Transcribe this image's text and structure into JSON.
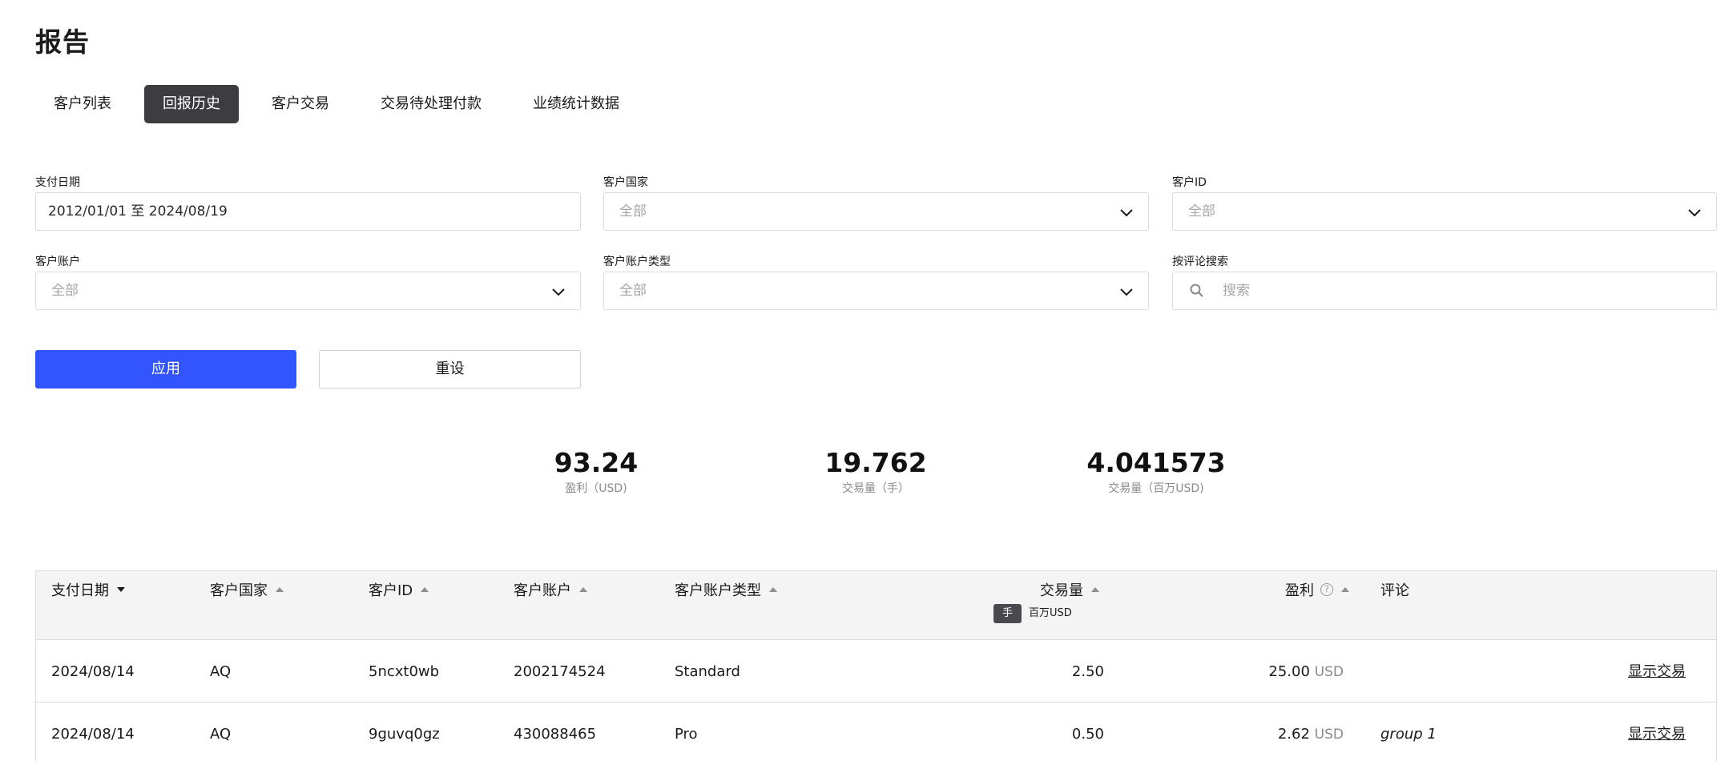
{
  "page": {
    "title": "报告"
  },
  "tabs": [
    {
      "label": "客户列表",
      "active": false
    },
    {
      "label": "回报历史",
      "active": true
    },
    {
      "label": "客户交易",
      "active": false
    },
    {
      "label": "交易待处理付款",
      "active": false
    },
    {
      "label": "业绩统计数据",
      "active": false
    }
  ],
  "filters": {
    "pay_date": {
      "label": "支付日期",
      "value": "2012/01/01 至 2024/08/19"
    },
    "client_country": {
      "label": "客户国家",
      "placeholder": "全部"
    },
    "client_id": {
      "label": "客户ID",
      "placeholder": "全部"
    },
    "client_account": {
      "label": "客户账户",
      "placeholder": "全部"
    },
    "client_account_type": {
      "label": "客户账户类型",
      "placeholder": "全部"
    },
    "comment_search": {
      "label": "按评论搜索",
      "placeholder": "搜索"
    }
  },
  "actions": {
    "apply_label": "应用",
    "reset_label": "重设"
  },
  "summary": [
    {
      "value": "93.24",
      "label": "盈利（USD)"
    },
    {
      "value": "19.762",
      "label": "交易量（手）"
    },
    {
      "value": "4.041573",
      "label": "交易量（百万USD)"
    }
  ],
  "table": {
    "headers": {
      "pay_date": "支付日期",
      "client_country": "客户国家",
      "client_id": "客户ID",
      "client_account": "客户账户",
      "account_type": "客户账户类型",
      "volume": "交易量",
      "profit": "盈利",
      "comment": "评论"
    },
    "help_glyph": "?",
    "volume_units": {
      "active": "手",
      "other": "百万USD"
    },
    "rows": [
      {
        "pay_date": "2024/08/14",
        "country": "AQ",
        "client_id": "5ncxt0wb",
        "account": "2002174524",
        "account_type": "Standard",
        "volume": "2.50",
        "profit": "25.00",
        "currency": "USD",
        "comment": "",
        "action": "显示交易"
      },
      {
        "pay_date": "2024/08/14",
        "country": "AQ",
        "client_id": "9guvq0gz",
        "account": "430088465",
        "account_type": "Pro",
        "volume": "0.50",
        "profit": "2.62",
        "currency": "USD",
        "comment": "group 1",
        "action": "显示交易"
      }
    ]
  },
  "colors": {
    "primary": "#3355ff",
    "active_tab": "#3d3c41",
    "header_bg": "#f4f4f4",
    "border": "#dcdcdc"
  }
}
